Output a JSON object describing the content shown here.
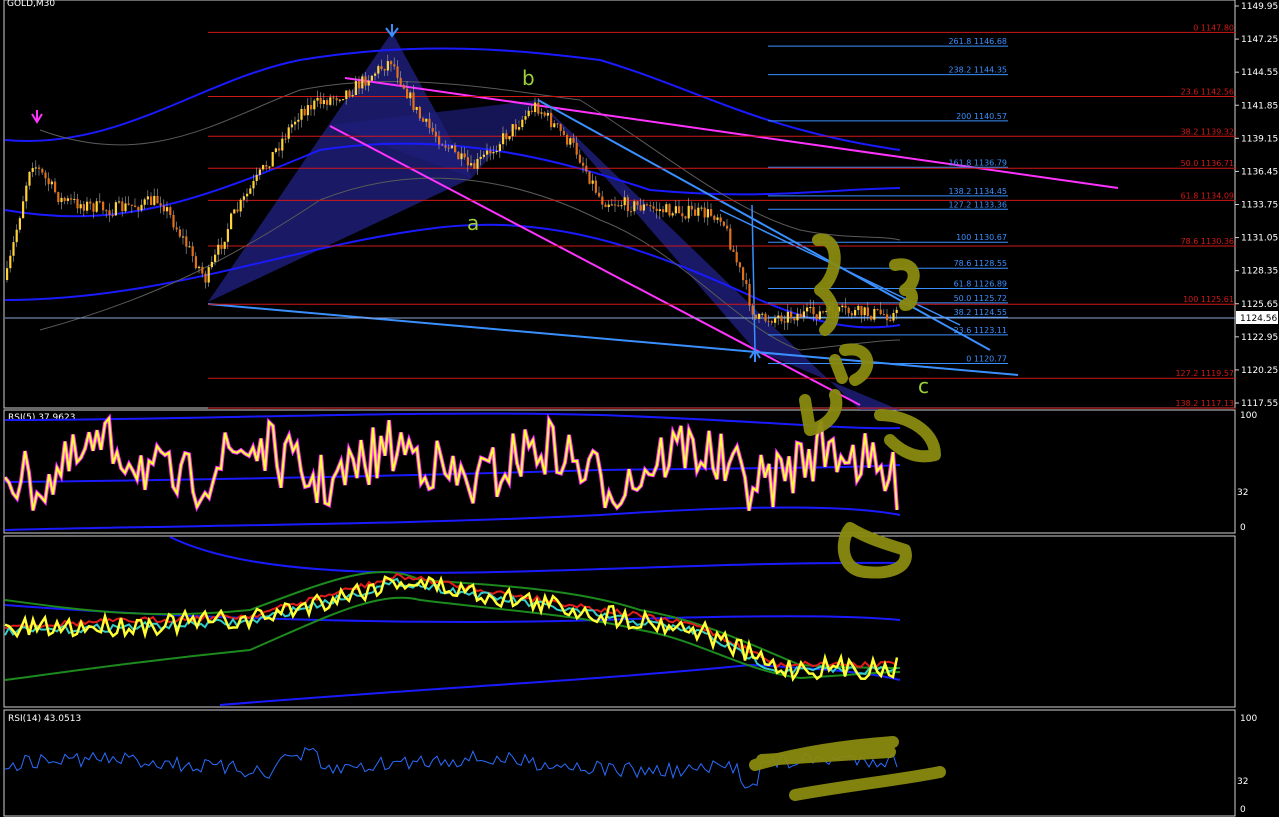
{
  "symbol_label": "GOLD,M30",
  "waves": {
    "a": "a",
    "b": "b",
    "c": "c"
  },
  "price_axis": [
    "1149.95",
    "1147.25",
    "1144.55",
    "1141.85",
    "1139.15",
    "1136.45",
    "1133.75",
    "1131.05",
    "1128.35",
    "1125.65",
    "1122.95",
    "1120.25",
    "1117.55"
  ],
  "current_price": "1124.56",
  "fib_left": [
    {
      "label": "261.8 1146.68",
      "price": 1146.68
    },
    {
      "label": "238.2 1144.35",
      "price": 1144.35
    },
    {
      "label": "200 1140.57",
      "price": 1140.57
    },
    {
      "label": "161.8 1136.79",
      "price": 1136.79
    },
    {
      "label": "138.2 1134.45",
      "price": 1134.45
    },
    {
      "label": "127.2 1133.36",
      "price": 1133.36
    },
    {
      "label": "100 1130.67",
      "price": 1130.67
    },
    {
      "label": "78.6 1128.55",
      "price": 1128.55
    },
    {
      "label": "61.8 1126.89",
      "price": 1126.89
    },
    {
      "label": "50.0 1125.72",
      "price": 1125.72
    },
    {
      "label": "38.2 1124.55",
      "price": 1124.55
    },
    {
      "label": "23.6 1123.11",
      "price": 1123.11
    },
    {
      "label": "0 1120.77",
      "price": 1120.77
    }
  ],
  "fib_right": [
    {
      "label": "0 1147.80",
      "price": 1147.8
    },
    {
      "label": "23.6 1142.56",
      "price": 1142.56
    },
    {
      "label": "38.2 1139.32",
      "price": 1139.32
    },
    {
      "label": "50.0 1136.71",
      "price": 1136.71
    },
    {
      "label": "61.8 1134.09",
      "price": 1134.09
    },
    {
      "label": "78.6 1130.36",
      "price": 1130.36
    },
    {
      "label": "100 1125.61",
      "price": 1125.61
    },
    {
      "label": "127.2 1119.57",
      "price": 1119.57
    },
    {
      "label": "138.2 1117.13",
      "price": 1117.13
    }
  ],
  "rsi5": {
    "label": "RSI(5) 37.9623",
    "levels": [
      "100",
      "32",
      "0"
    ]
  },
  "rsi14": {
    "label": "RSI(14) 43.0513",
    "levels": [
      "100",
      "32",
      "0"
    ]
  },
  "colors": {
    "bg": "#000000",
    "fib_red": "#d01818",
    "fib_blue": "#3a8fff",
    "rsi_yellow": "#ffff33",
    "magenta": "#ff33ff",
    "band_blue": "#1a1aff",
    "scrawl": "#8a8a10"
  }
}
